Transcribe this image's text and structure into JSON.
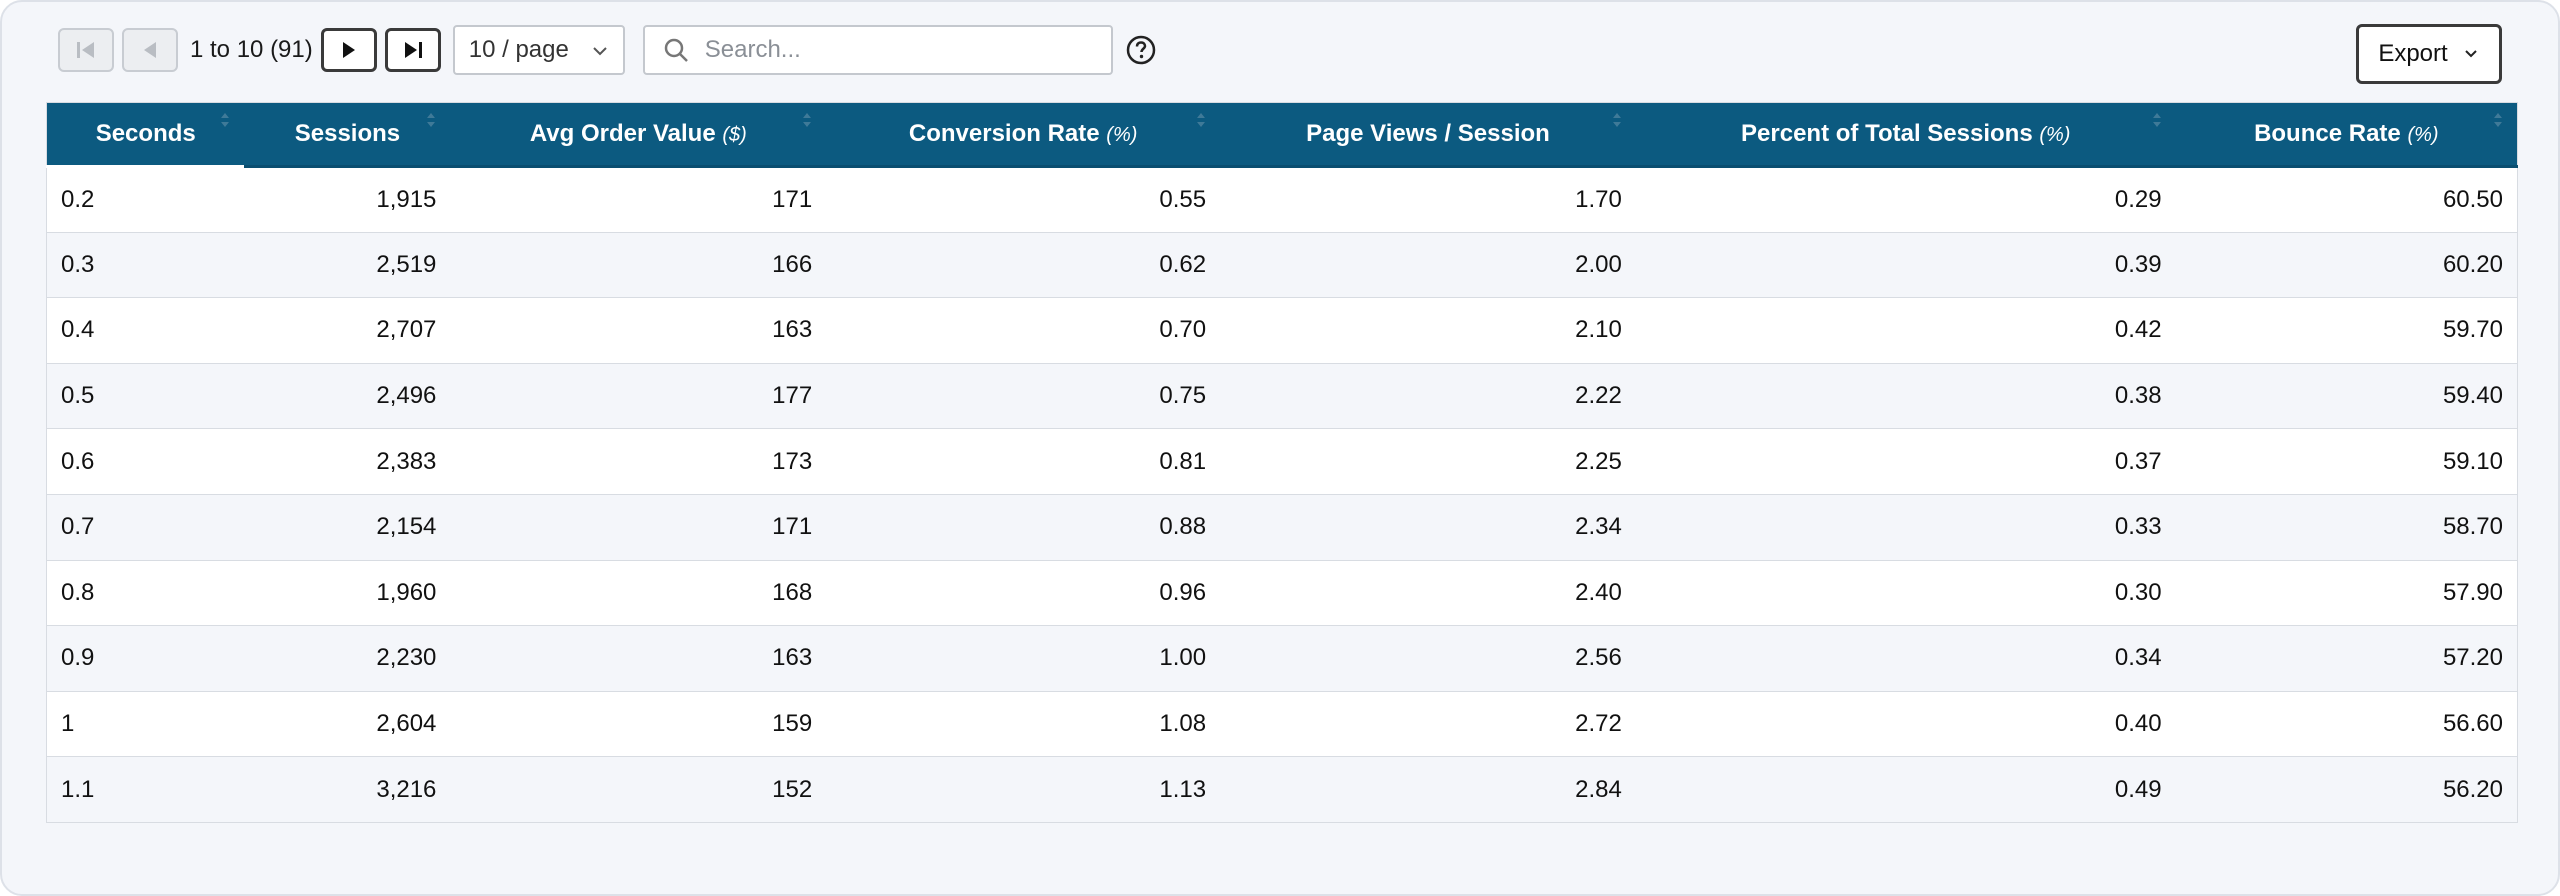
{
  "pagination": {
    "range_text": "1 to 10 (91)",
    "page_size": "10 / page"
  },
  "search": {
    "placeholder": "Search..."
  },
  "export": {
    "label": "Export"
  },
  "table": {
    "columns": [
      {
        "label": "Seconds",
        "unit": ""
      },
      {
        "label": "Sessions",
        "unit": ""
      },
      {
        "label": "Avg Order Value ",
        "unit": "($)"
      },
      {
        "label": "Conversion Rate ",
        "unit": "(%)"
      },
      {
        "label": "Page Views / Session",
        "unit": ""
      },
      {
        "label": "Percent of Total Sessions ",
        "unit": "(%)"
      },
      {
        "label": "Bounce Rate ",
        "unit": "(%)"
      }
    ],
    "rows": [
      [
        "0.2",
        "1,915",
        "171",
        "0.55",
        "1.70",
        "0.29",
        "60.50"
      ],
      [
        "0.3",
        "2,519",
        "166",
        "0.62",
        "2.00",
        "0.39",
        "60.20"
      ],
      [
        "0.4",
        "2,707",
        "163",
        "0.70",
        "2.10",
        "0.42",
        "59.70"
      ],
      [
        "0.5",
        "2,496",
        "177",
        "0.75",
        "2.22",
        "0.38",
        "59.40"
      ],
      [
        "0.6",
        "2,383",
        "173",
        "0.81",
        "2.25",
        "0.37",
        "59.10"
      ],
      [
        "0.7",
        "2,154",
        "171",
        "0.88",
        "2.34",
        "0.33",
        "58.70"
      ],
      [
        "0.8",
        "1,960",
        "168",
        "0.96",
        "2.40",
        "0.30",
        "57.90"
      ],
      [
        "0.9",
        "2,230",
        "163",
        "1.00",
        "2.56",
        "0.34",
        "57.20"
      ],
      [
        "1",
        "2,604",
        "159",
        "1.08",
        "2.72",
        "0.40",
        "56.60"
      ],
      [
        "1.1",
        "3,216",
        "152",
        "1.13",
        "2.84",
        "0.49",
        "56.20"
      ]
    ]
  },
  "icons": {
    "first_page": "first-page-icon",
    "prev_page": "prev-page-icon",
    "next_page": "next-page-icon",
    "last_page": "last-page-icon",
    "search": "search-icon",
    "help": "help-circle-icon",
    "dropdown": "chevron-down-icon",
    "sort": "sort-arrows-icon"
  },
  "colors": {
    "header_bg": "#0c5a80",
    "header_text": "#ffffff",
    "row_alt": "#f4f6fa"
  }
}
